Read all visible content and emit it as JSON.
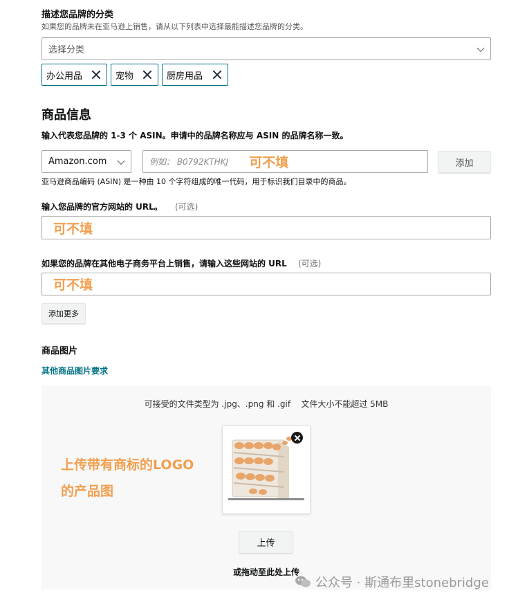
{
  "category": {
    "title": "描述您品牌的分类",
    "desc": "如果您的品牌未在亚马逊上销售，请从以下列表中选择最能描述您品牌的分类。",
    "placeholder": "选择分类",
    "chips": [
      "办公用品",
      "宠物",
      "厨房用品"
    ]
  },
  "product_info": {
    "heading": "商品信息",
    "asin_label": "输入代表您品牌的 1-3 个 ASIN。申请中的品牌名称应与 ASIN 的品牌名称一致。",
    "marketplace": "Amazon.com",
    "asin_placeholder": "例如： B0792KTHKJ",
    "annotation": "可不填",
    "add_button": "添加",
    "asin_help": "亚马逊商品编码 (ASIN) 是一种由 10 个字符组成的唯一代码，用于标识我们目录中的商品。"
  },
  "website": {
    "label": "输入您品牌的官方网站的 URL。",
    "optional": "(可选)",
    "annotation": "可不填"
  },
  "other_sites": {
    "label": "如果您的品牌在其他电子商务平台上销售，请输入这些网站的 URL",
    "optional": "(可选)",
    "annotation": "可不填",
    "add_more": "添加更多"
  },
  "images": {
    "heading": "商品图片",
    "requirements_link": "其他商品图片要求",
    "file_note": "可接受的文件类型为 .jpg、.png 和 .gif    文件大小不能超过 5MB",
    "annotation_line1": "上传带有商标的LOGO",
    "annotation_line2": "的产品图",
    "upload_button": "上传",
    "drag_text": "或拖动至此处上传"
  },
  "watermark": "公众号 · 斯通布里stonebridge",
  "colors": {
    "accent": "#007185",
    "annotation": "#f0a050"
  }
}
